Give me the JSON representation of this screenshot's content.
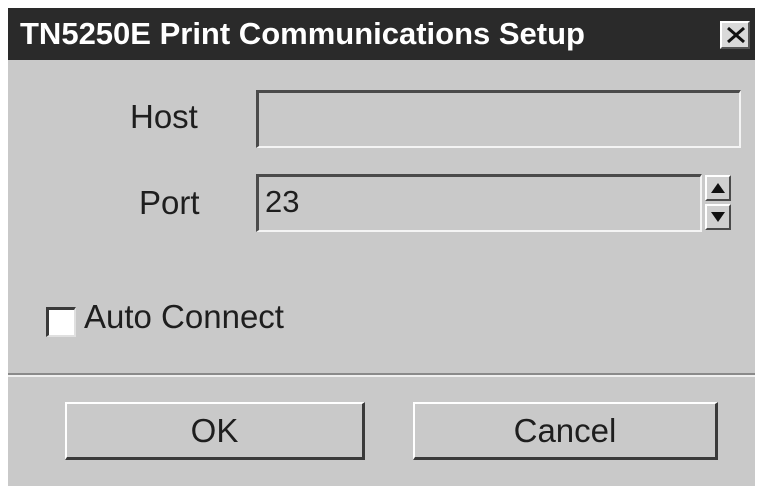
{
  "window": {
    "title": "TN5250E Print Communications Setup",
    "close_icon": "close-icon"
  },
  "form": {
    "host_label": "Host",
    "host_value": "",
    "port_label": "Port",
    "port_value": "23",
    "spin_up_icon": "arrow-up-icon",
    "spin_down_icon": "arrow-down-icon",
    "auto_connect_label": "Auto Connect",
    "auto_connect_checked": false
  },
  "buttons": {
    "ok_label": "OK",
    "cancel_label": "Cancel"
  },
  "colors": {
    "titlebar": "#2a2a2a",
    "dialog_bg": "#c9c9c9",
    "title_text": "#ffffff"
  }
}
